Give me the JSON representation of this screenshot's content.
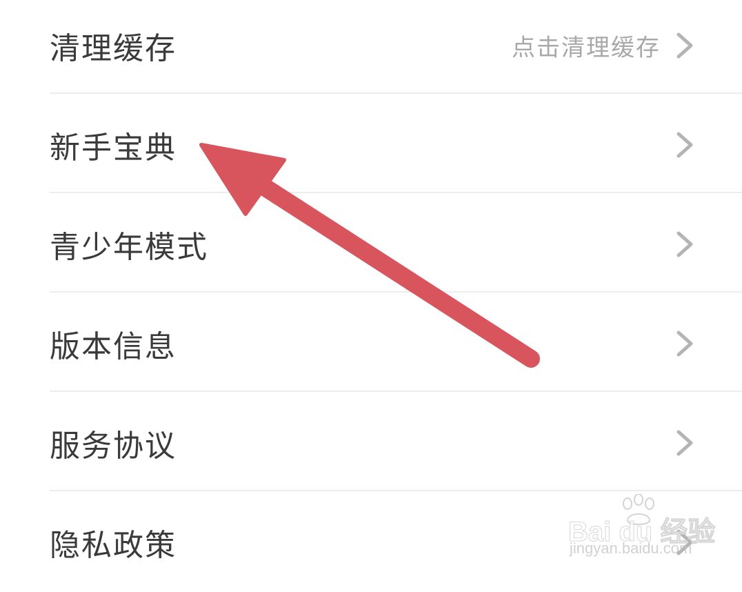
{
  "settings": {
    "items": [
      {
        "label": "清理缓存",
        "value": "点击清理缓存",
        "icon": "chevron-right-icon"
      },
      {
        "label": "新手宝典",
        "value": "",
        "icon": "chevron-right-icon"
      },
      {
        "label": "青少年模式",
        "value": "",
        "icon": "chevron-right-icon"
      },
      {
        "label": "版本信息",
        "value": "",
        "icon": "chevron-right-icon"
      },
      {
        "label": "服务协议",
        "value": "",
        "icon": "chevron-right-icon"
      },
      {
        "label": "隐私政策",
        "value": "",
        "icon": "chevron-right-icon"
      }
    ]
  },
  "annotation": {
    "arrow_color": "#d9555e",
    "target_item": "新手宝典"
  },
  "watermark": {
    "brand": "Bai du 经验",
    "url": "jingyan.baidu.com"
  },
  "colors": {
    "label_text": "#3a3a3a",
    "value_text": "#a8a8a8",
    "chevron": "#b4b4b4",
    "divider": "#ededed",
    "background": "#ffffff"
  }
}
